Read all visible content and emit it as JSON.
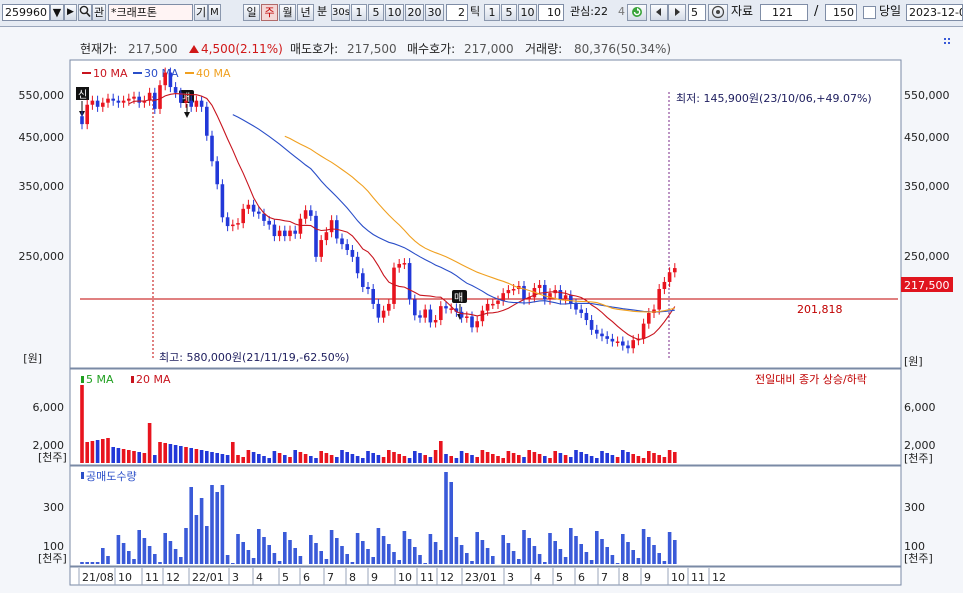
{
  "toolbar": {
    "code": "259960",
    "code_btn_arrow": "▼",
    "code_btn_next": "▶",
    "search_icon": "search-icon",
    "kwan": "관",
    "name": "*크래프톤",
    "gi": "기",
    "m": "M",
    "periods": [
      "일",
      "주",
      "월",
      "년",
      "분",
      "30s",
      "1",
      "5",
      "10",
      "20",
      "30"
    ],
    "selected_period": "주",
    "tick_value": "2",
    "tick_label": "틱",
    "tick_opts": [
      "1",
      "5",
      "10"
    ],
    "ten": "10",
    "watch_label": "관심:22",
    "watch_suffix": "4",
    "count": "5",
    "data_label": "자료",
    "data_value": "121",
    "slash": "/",
    "max": "150",
    "today_label": "당일",
    "date": "2023-12-0"
  },
  "info": {
    "price_label": "현재가:",
    "price": "217,500",
    "change": "4,500(2.11%)",
    "ask_label": "매도호가:",
    "ask": "217,500",
    "bid_label": "매수호가:",
    "bid": "217,000",
    "vol_label": "거래량:",
    "vol": "80,376(50.34%)"
  },
  "legend": {
    "ma10": "10 MA",
    "ma30": "30 MA",
    "ma40": "40 MA"
  },
  "price_axis": [
    "550,000",
    "450,000",
    "350,000",
    "250,000"
  ],
  "price_unit": "[원]",
  "annotations": {
    "low": "최저: 145,900원(23/10/06,+49.07%)",
    "high": "최고: 580,000원(21/11/19,-62.50%)",
    "hline": "201,818",
    "current": "217,500",
    "shin": "신",
    "me1": "매",
    "me2": "매"
  },
  "vol_panel": {
    "ma5": "5 MA",
    "ma20": "20 MA",
    "note": "전일대비 종가 상승/하락",
    "axis": [
      "6,000",
      "2,000"
    ],
    "unit": "[천주]"
  },
  "short_panel": {
    "title": "공매도수량",
    "axis": [
      "300",
      "100"
    ],
    "unit": "[천주]"
  },
  "x_axis": [
    "21/08",
    "10",
    "11",
    "12",
    "22/01",
    "3",
    "4",
    "5",
    "6",
    "7",
    "8",
    "9",
    "10",
    "11",
    "12",
    "23/01",
    "3",
    "4",
    "5",
    "6",
    "7",
    "8",
    "9",
    "10",
    "11",
    "12"
  ],
  "colors": {
    "up": "#e8141e",
    "down": "#2238d8",
    "ma10": "#c8141e",
    "ma30": "#2a4ec8",
    "ma40": "#f0a020",
    "bg": "#f4f6fa"
  },
  "chart_data": {
    "type": "candlestick",
    "weeks": 121,
    "close": [
      445000,
      490000,
      500000,
      485000,
      495000,
      505000,
      500000,
      495000,
      500000,
      505000,
      510000,
      495000,
      500000,
      520000,
      480000,
      540000,
      575000,
      535000,
      520000,
      495000,
      500000,
      485000,
      500000,
      485000,
      420000,
      370000,
      330000,
      280000,
      268000,
      270000,
      272000,
      292000,
      298000,
      288000,
      285000,
      275000,
      270000,
      255000,
      262000,
      255000,
      262000,
      258000,
      278000,
      290000,
      282000,
      230000,
      250000,
      260000,
      276000,
      252000,
      245000,
      238000,
      230000,
      212000,
      198000,
      196000,
      182000,
      170000,
      176000,
      182000,
      218000,
      222000,
      223000,
      186000,
      172000,
      170000,
      177000,
      166000,
      168000,
      180000,
      178000,
      178000,
      175000,
      170000,
      171000,
      162000,
      167000,
      176000,
      182000,
      182000,
      185000,
      192000,
      195000,
      196000,
      199000,
      186000,
      188000,
      197000,
      200000,
      186000,
      192000,
      195000,
      186000,
      190000,
      182000,
      177000,
      174000,
      168000,
      160000,
      157000,
      155000,
      153000,
      151000,
      151000,
      148000,
      146000,
      152000,
      153000,
      165000,
      174000,
      177000,
      196000,
      203000,
      213000,
      217500
    ],
    "price_ylim": [
      135000,
      600000
    ],
    "ma10_last": 180000,
    "ma30_last": 180000,
    "ma40_last": 182000,
    "short_volume_note": "공매도수량 bars",
    "xlabel": "",
    "ylabel": ""
  }
}
